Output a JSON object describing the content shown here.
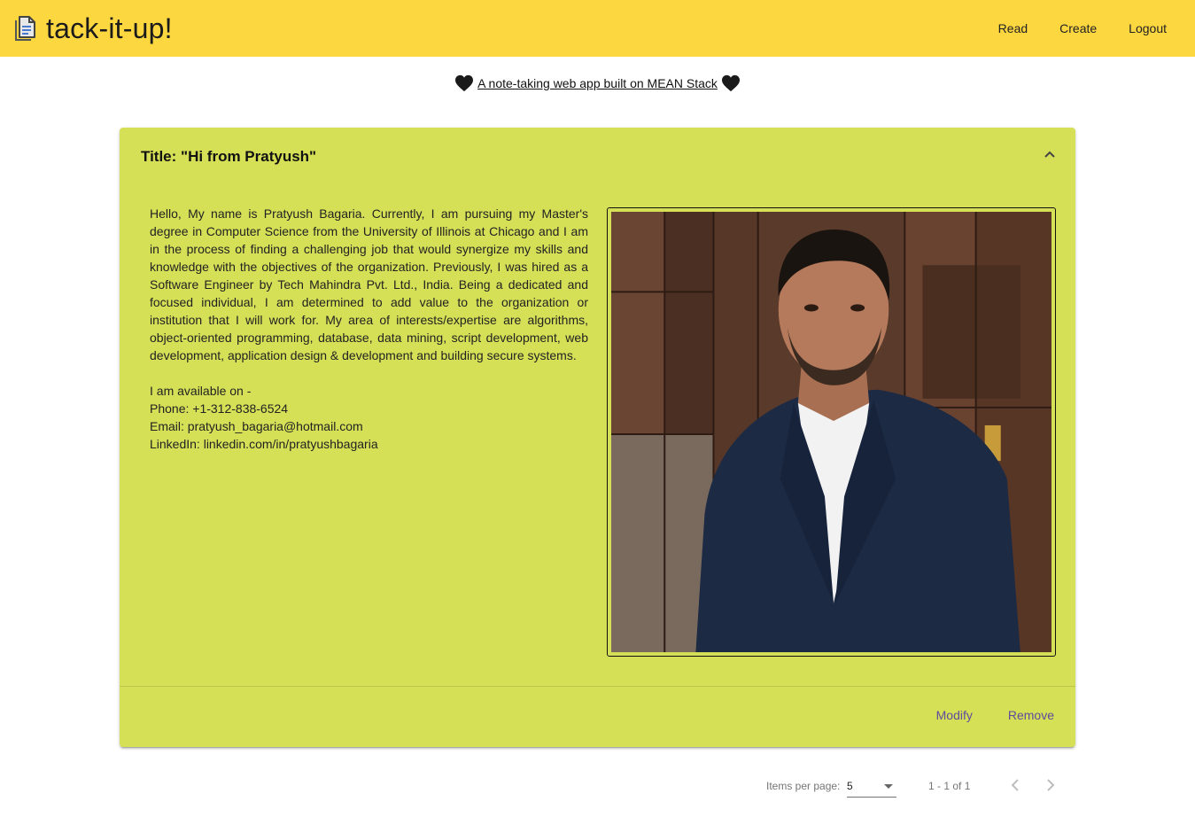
{
  "app": {
    "name": "tack-it-up!",
    "brand_color": "#fdd73f"
  },
  "nav": {
    "read": "Read",
    "create": "Create",
    "logout": "Logout"
  },
  "tagline": "A note-taking web app built on MEAN Stack",
  "note": {
    "title": "Title: \"Hi from Pratyush\"",
    "card_color": "#d5e056",
    "body": "Hello, My name is Pratyush Bagaria. Currently, I am pursuing my Master's degree in Computer Science from the University of Illinois at Chicago and I am in the process of finding a challenging job that would synergize my skills and knowledge with the objectives of the organization. Previously, I was hired as a Software Engineer by Tech Mahindra Pvt. Ltd., India. Being a dedicated and focused individual, I am determined to add value to the organization or institution that I will work for. My area of interests/expertise are algorithms, object-oriented programming, database, data mining, script development, web development, application design & development and building secure systems.",
    "availability": "I am available on -",
    "phone": "Phone: +1-312-838-6524",
    "email": "Email: pratyush_bagaria@hotmail.com",
    "linkedin": "LinkedIn: linkedin.com/in/pratyushbagaria",
    "actions": {
      "modify": "Modify",
      "remove": "Remove"
    }
  },
  "paginator": {
    "items_per_page_label": "Items per page:",
    "page_size": "5",
    "range_label": "1 - 1 of 1"
  },
  "icons": {
    "brand": "note-document-icon",
    "heart": "heart-icon",
    "collapse": "chevron-up-icon",
    "prev": "chevron-left-icon",
    "next": "chevron-right-icon",
    "dropdown": "arrow-drop-down-icon"
  }
}
